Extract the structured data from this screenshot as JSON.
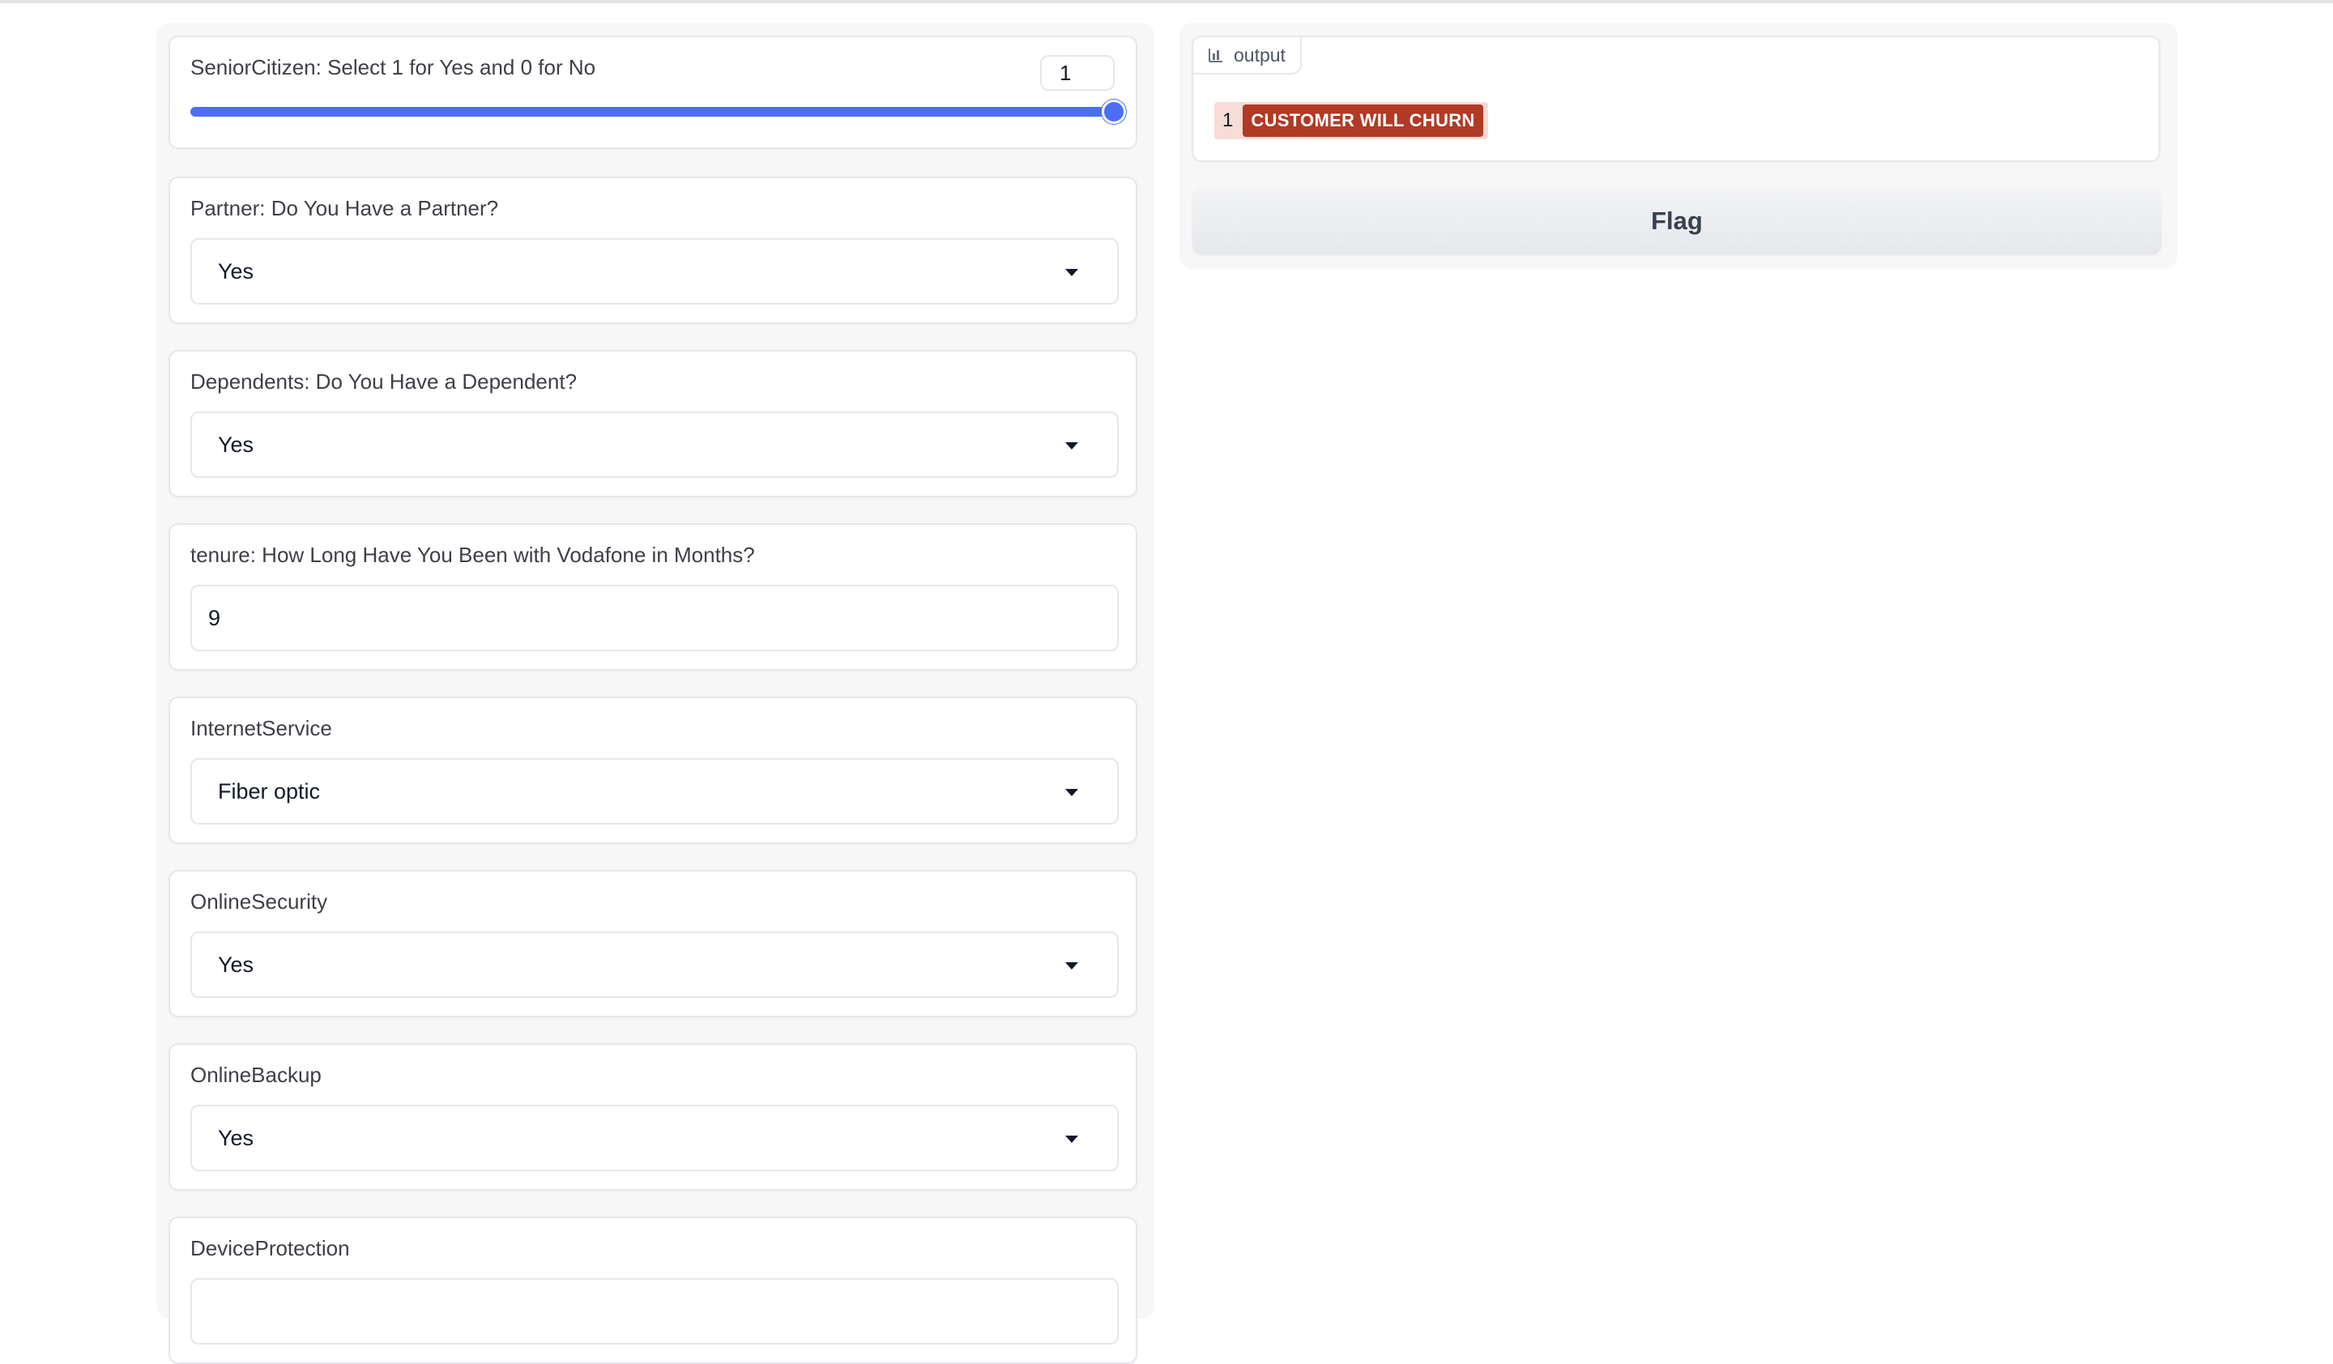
{
  "senior_citizen": {
    "label": "SeniorCitizen: Select 1 for Yes and 0 for No",
    "value": "1",
    "min": 0,
    "max": 1,
    "level": 1.0
  },
  "partner": {
    "label": "Partner: Do You Have a Partner?",
    "value": "Yes"
  },
  "dependents": {
    "label": "Dependents: Do You Have a Dependent?",
    "value": "Yes"
  },
  "tenure": {
    "label": "tenure: How Long Have You Been with Vodafone in Months?",
    "value": "9"
  },
  "internet_service": {
    "label": "InternetService",
    "value": "Fiber optic"
  },
  "online_security": {
    "label": "OnlineSecurity",
    "value": "Yes"
  },
  "online_backup": {
    "label": "OnlineBackup",
    "value": "Yes"
  },
  "device_protection": {
    "label": "DeviceProtection"
  },
  "output": {
    "tab_label": "output",
    "result_index": "1",
    "result_text": "CUSTOMER WILL CHURN",
    "result_color": "#b13a25",
    "result_bg": "#f9dcd7"
  },
  "actions": {
    "flag_label": "Flag"
  },
  "colors": {
    "accent": "#4c6ef5",
    "panel_bg": "#f7f7f8",
    "border": "#e5e7eb"
  },
  "icons": {
    "output_tab": "chart-icon",
    "dropdown": "caret-down-icon"
  }
}
